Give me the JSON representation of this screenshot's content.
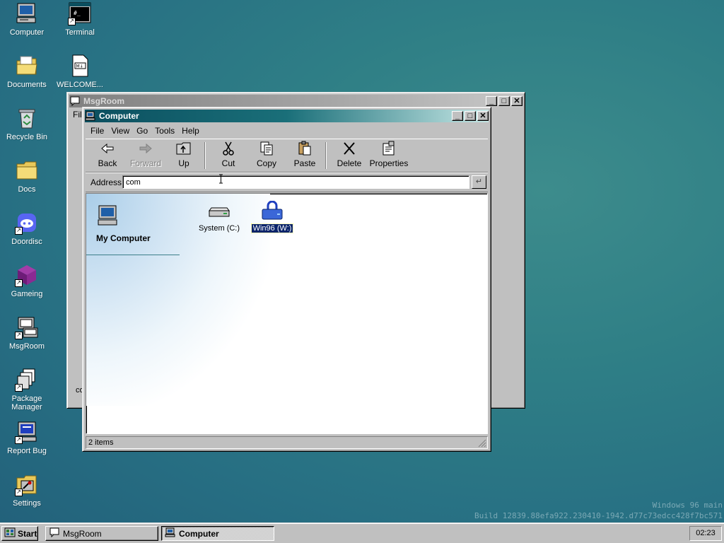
{
  "desktop": {
    "icons": [
      {
        "label": "Computer",
        "icon": "computer-icon"
      },
      {
        "label": "Terminal",
        "icon": "terminal-icon"
      },
      {
        "label": "Documents",
        "icon": "documents-folder-icon"
      },
      {
        "label": "WELCOME...",
        "icon": "markdown-file-icon",
        "file_badge": "M↓"
      },
      {
        "label": "Recycle Bin",
        "icon": "recycle-bin-icon"
      },
      {
        "label": "Docs",
        "icon": "folder-icon"
      },
      {
        "label": "Doordisc",
        "icon": "doordisc-icon"
      },
      {
        "label": "Gameing",
        "icon": "game-cube-icon"
      },
      {
        "label": "MsgRoom",
        "icon": "msgroom-icon"
      },
      {
        "label": "Package Manager",
        "icon": "package-manager-icon"
      },
      {
        "label": "Report Bug",
        "icon": "report-bug-icon"
      },
      {
        "label": "Settings",
        "icon": "settings-icon"
      }
    ],
    "terminal_prompt": "#_"
  },
  "msgroom_window": {
    "title": "MsgRoom",
    "menu_partial": "File",
    "input_partial": "co"
  },
  "computer_window": {
    "title": "Computer",
    "menu": [
      "File",
      "View",
      "Go",
      "Tools",
      "Help"
    ],
    "toolbar": {
      "back": "Back",
      "forward": "Forward",
      "up": "Up",
      "cut": "Cut",
      "copy": "Copy",
      "paste": "Paste",
      "delete": "Delete",
      "properties": "Properties"
    },
    "address_label": "Address",
    "address_value": "com",
    "address_go": "↵",
    "side_title": "My Computer",
    "items": [
      {
        "label": "System (C:)",
        "icon": "hard-drive-icon",
        "selected": false
      },
      {
        "label": "Win96 (W:)",
        "icon": "locked-drive-icon",
        "selected": true
      }
    ],
    "status": "2 items"
  },
  "taskbar": {
    "start_label": "Start",
    "tasks": [
      {
        "label": "MsgRoom",
        "pressed": false
      },
      {
        "label": "Computer",
        "pressed": true
      }
    ],
    "clock": "02:23"
  },
  "watermark": {
    "line1": "Windows 96 main",
    "line2": "Build 12839.88efa922.230410-1942.d77c73edcc428f7bc571"
  },
  "colors": {
    "desktop": "#2f7f86",
    "title_active": "#0b4f5f",
    "selection": "#0a246a"
  }
}
